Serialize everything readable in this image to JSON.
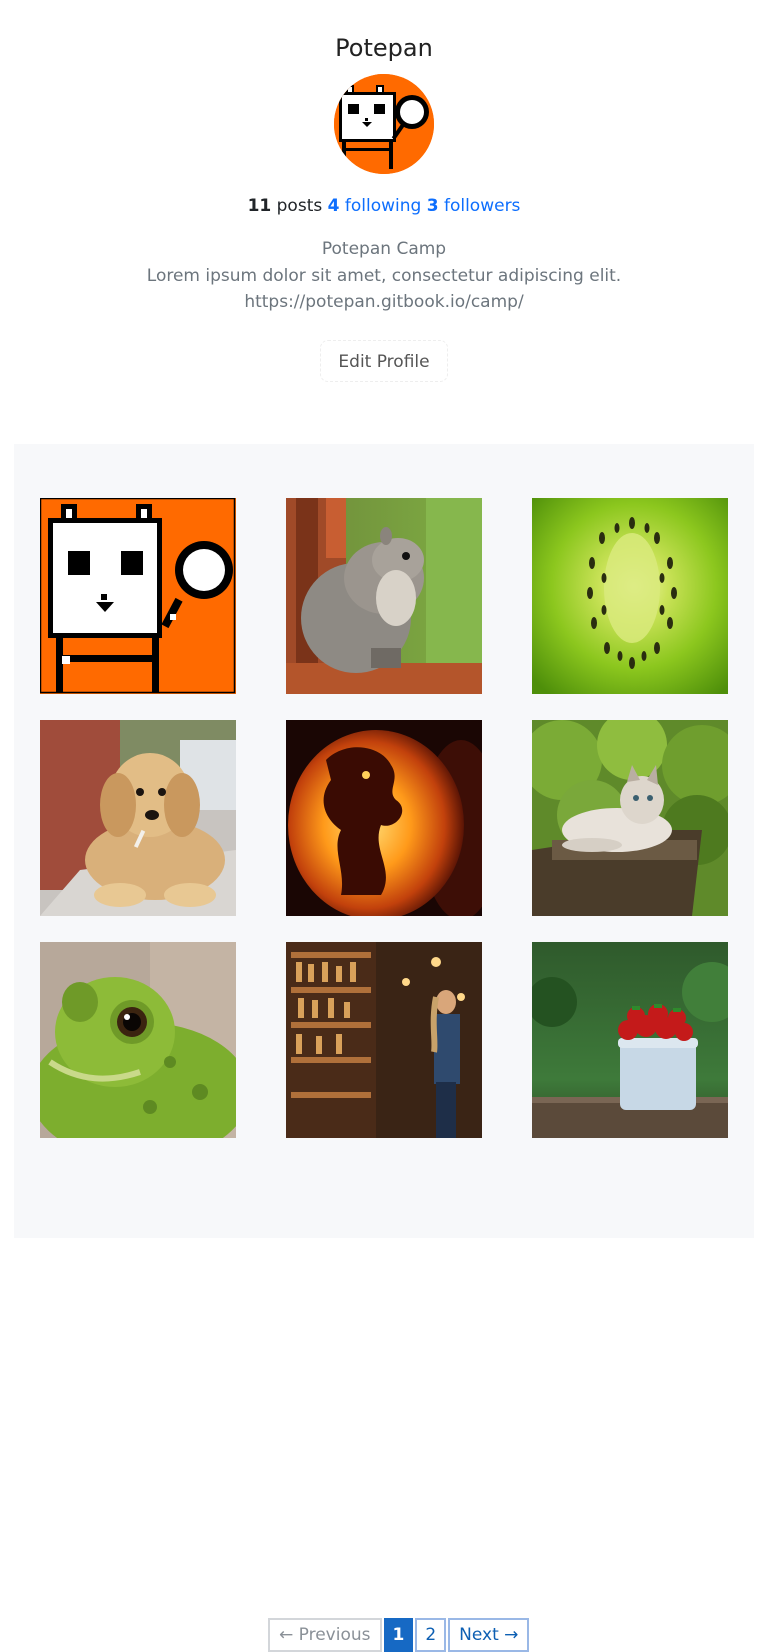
{
  "profile": {
    "username": "Potepan",
    "avatar_icon": "robot-mascot-icon",
    "stats": {
      "posts_count": "11",
      "posts_label": "posts",
      "following_count": "4",
      "following_label": "following",
      "followers_count": "3",
      "followers_label": "followers"
    },
    "bio": {
      "name": "Potepan Camp",
      "description": "Lorem ipsum dolor sit amet, consectetur adipiscing elit.",
      "website": "https://potepan.gitbook.io/camp/"
    },
    "edit_button_label": "Edit Profile"
  },
  "posts": [
    {
      "subject": "robot-mascot"
    },
    {
      "subject": "squirrel"
    },
    {
      "subject": "kiwi-slice"
    },
    {
      "subject": "puppy"
    },
    {
      "subject": "carved-pumpkin"
    },
    {
      "subject": "cat-on-stump"
    },
    {
      "subject": "frog"
    },
    {
      "subject": "shop-shelves"
    },
    {
      "subject": "strawberries-bowl"
    }
  ],
  "pagination": {
    "previous_label": "← Previous",
    "pages": [
      "1",
      "2"
    ],
    "current_page": "1",
    "next_label": "Next →"
  },
  "colors": {
    "brand_orange": "#ff6a00",
    "link_blue": "#0d6efd",
    "active_page": "#1669c4"
  }
}
